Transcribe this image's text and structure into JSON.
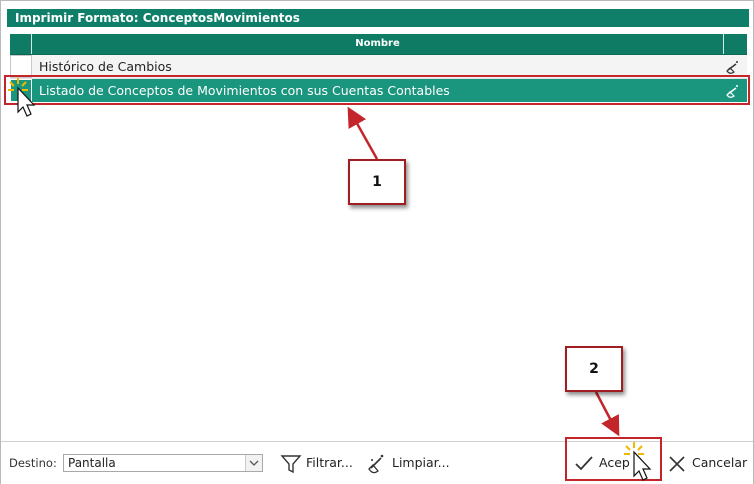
{
  "dialog": {
    "title": "Imprimir Formato: ConceptosMovimientos"
  },
  "grid": {
    "column_header": "Nombre",
    "rows": [
      {
        "label": "Histórico de Cambios",
        "selected": false
      },
      {
        "label": "Listado de Conceptos de Movimientos con sus Cuentas Contables",
        "selected": true
      }
    ]
  },
  "annotations": {
    "callout1": "1",
    "callout2": "2"
  },
  "footer": {
    "destino_label": "Destino:",
    "destino_value": "Pantalla",
    "filter_label": "Filtrar...",
    "clean_label": "Limpiar...",
    "accept_label": "Acep",
    "cancel_label": "Cancelar"
  },
  "colors": {
    "header_green": "#107f69",
    "row_selected": "#1a957e",
    "annotation_red": "#c2262b"
  }
}
